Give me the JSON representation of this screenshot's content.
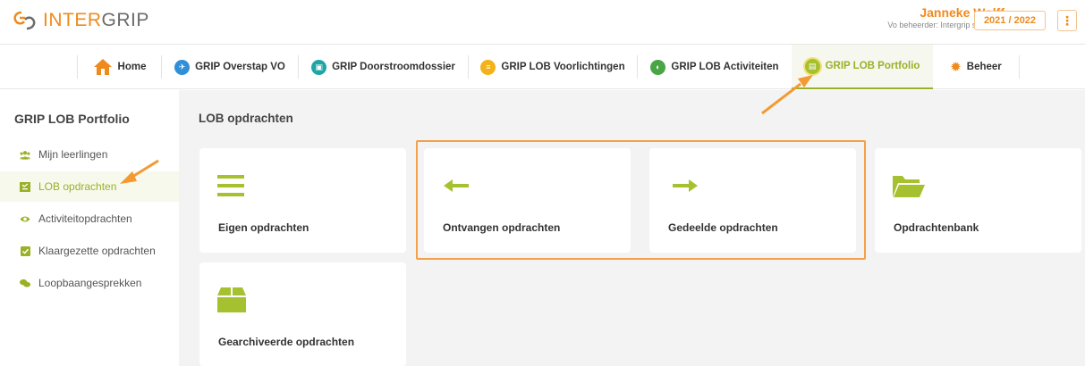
{
  "header": {
    "logo_prefix": "INTER",
    "logo_suffix": "GRIP",
    "user_name": "Janneke Wolff",
    "user_role": "Vo beheerder: Intergrip school",
    "school_year": "2021 / 2022",
    "menu_glyph": "⋮"
  },
  "nav": {
    "items": [
      {
        "label": "Home",
        "icon": "home-icon",
        "color": "#f08a1c"
      },
      {
        "label": "GRIP Overstap VO",
        "icon": "overstap-icon",
        "color": "#2f8fd8"
      },
      {
        "label": "GRIP Doorstroomdossier",
        "icon": "doorstroom-icon",
        "color": "#1ea6a6"
      },
      {
        "label": "GRIP LOB Voorlichtingen",
        "icon": "voorlichtingen-icon",
        "color": "#f2b21b"
      },
      {
        "label": "GRIP LOB Activiteiten",
        "icon": "activiteiten-icon",
        "color": "#4aa545"
      },
      {
        "label": "GRIP LOB Portfolio",
        "icon": "portfolio-icon",
        "color": "#a6c12f"
      },
      {
        "label": "Beheer",
        "icon": "gear-icon",
        "color": "#f08a1c"
      }
    ]
  },
  "sidebar": {
    "title": "GRIP LOB Portfolio",
    "items": [
      {
        "label": "Mijn leerlingen",
        "icon": "users-icon"
      },
      {
        "label": "LOB opdrachten",
        "icon": "tasks-icon"
      },
      {
        "label": "Activiteitopdrachten",
        "icon": "eye-icon"
      },
      {
        "label": "Klaargezette opdrachten",
        "icon": "checkbox-icon"
      },
      {
        "label": "Loopbaangesprekken",
        "icon": "chat-icon"
      }
    ]
  },
  "main": {
    "title": "LOB opdrachten",
    "cards": [
      {
        "label": "Eigen opdrachten",
        "icon": "list-icon"
      },
      {
        "label": "Ontvangen opdrachten",
        "icon": "arrow-left-icon"
      },
      {
        "label": "Gedeelde opdrachten",
        "icon": "arrow-right-icon"
      },
      {
        "label": "Opdrachtenbank",
        "icon": "folder-open-icon"
      },
      {
        "label": "Gearchiveerde opdrachten",
        "icon": "archive-box-icon"
      }
    ]
  },
  "colors": {
    "accent_green": "#9bb026",
    "accent_orange": "#f08a1c",
    "annotation_orange": "#f5a04a"
  }
}
